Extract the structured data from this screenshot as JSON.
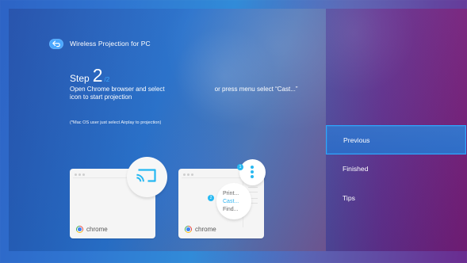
{
  "header": {
    "title": "Wireless Projection for PC",
    "back_icon": "back-icon",
    "accent_color": "#48a7ff"
  },
  "step": {
    "label": "Step",
    "current": "2",
    "total": "/2"
  },
  "instructions": {
    "line1_prefix": "Open Chrome browser and select",
    "line1_suffix": "or press menu select “Cast...”",
    "line2": "icon to start projection",
    "note": "(*Mac OS user just select Airplay to projection)"
  },
  "illustrations": {
    "left_card_brand": "chrome",
    "right_card_brand": "chrome",
    "cast_icon": "cast-icon",
    "menu_icon": "vertical-dots-icon",
    "callout_1": "1",
    "callout_2": "2",
    "menu_items": [
      "Print...",
      "Cast...",
      "Find..."
    ]
  },
  "side_menu": {
    "items": [
      {
        "label": "Previous",
        "selected": true
      },
      {
        "label": "Finished",
        "selected": false
      },
      {
        "label": "Tips",
        "selected": false
      }
    ],
    "selected_border_color": "#2aa8ff"
  }
}
